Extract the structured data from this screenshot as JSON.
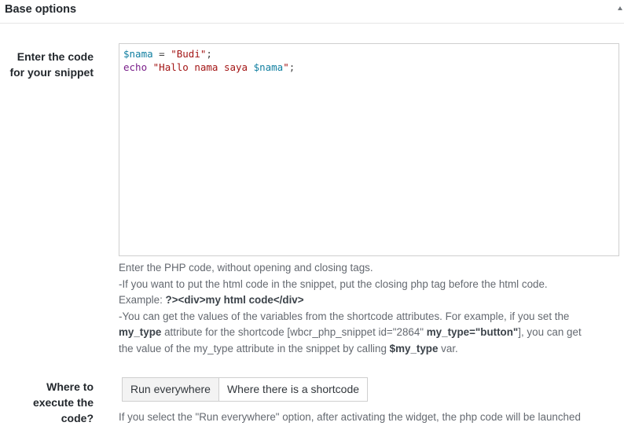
{
  "panel": {
    "title": "Base options"
  },
  "code_field": {
    "label": "Enter the code for your snippet",
    "lines": [
      [
        {
          "t": "var",
          "v": "$nama"
        },
        {
          "t": "op",
          "v": " = "
        },
        {
          "t": "str",
          "v": "\"Budi\""
        },
        {
          "t": "op",
          "v": ";"
        }
      ],
      [
        {
          "t": "kw",
          "v": "echo"
        },
        {
          "t": "op",
          "v": " "
        },
        {
          "t": "str",
          "v": "\"Hallo nama saya "
        },
        {
          "t": "var",
          "v": "$nama"
        },
        {
          "t": "str",
          "v": "\""
        },
        {
          "t": "op",
          "v": ";"
        }
      ]
    ]
  },
  "help": {
    "line1": "Enter the PHP code, without opening and closing tags.",
    "line2": "-If you want to put the html code in the snippet, put the closing php tag before the html code.",
    "example_prefix": "Example: ",
    "example_code": "?><div>my html code</div>",
    "line4": "-You can get the values of the variables from the shortcode attributes. For example, if you set the",
    "my_type_attr": "my_type",
    "attr_text": " attribute for the shortcode [wbcr_php_snippet id=\"2864\" ",
    "attr_example": "my_type=\"button\"",
    "attr_end": "], you can get",
    "line6_prefix": "the value of the my_type attribute in the snippet by calling ",
    "var_name": "$my_type",
    "line6_suffix": " var."
  },
  "execute": {
    "label": "Where to execute the code?",
    "options": [
      "Run everywhere",
      "Where there is a shortcode"
    ],
    "selected": "Run everywhere",
    "description": "If you select the \"Run everywhere\" option, after activating the widget, the php code will be launched"
  }
}
